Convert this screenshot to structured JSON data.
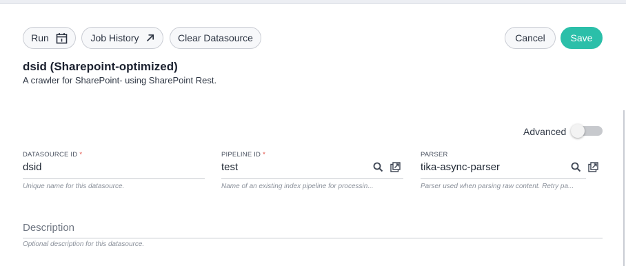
{
  "toolbar": {
    "run_label": "Run",
    "job_history_label": "Job History",
    "clear_label": "Clear Datasource",
    "cancel_label": "Cancel",
    "save_label": "Save"
  },
  "header": {
    "title": "dsid (Sharepoint-optimized)",
    "subtitle": "A crawler for SharePoint- using SharePoint Rest."
  },
  "advanced": {
    "label": "Advanced",
    "enabled": false
  },
  "fields": {
    "datasource_id": {
      "label": "DATASOURCE ID",
      "required_mark": "*",
      "value": "dsid",
      "hint": "Unique name for this datasource."
    },
    "pipeline_id": {
      "label": "PIPELINE ID",
      "required_mark": "*",
      "value": "test",
      "hint": "Name of an existing index pipeline for processin..."
    },
    "parser": {
      "label": "PARSER",
      "value": "tika-async-parser",
      "hint": "Parser used when parsing raw content. Retry pa..."
    },
    "description": {
      "placeholder": "Description",
      "hint": "Optional description for this datasource."
    }
  },
  "colors": {
    "accent": "#2bbfa9",
    "required": "#e0473c"
  },
  "icons": {
    "run": "calendar-icon",
    "job_history": "arrow-up-right-icon",
    "lookup": "search-icon",
    "open": "open-external-icon"
  }
}
